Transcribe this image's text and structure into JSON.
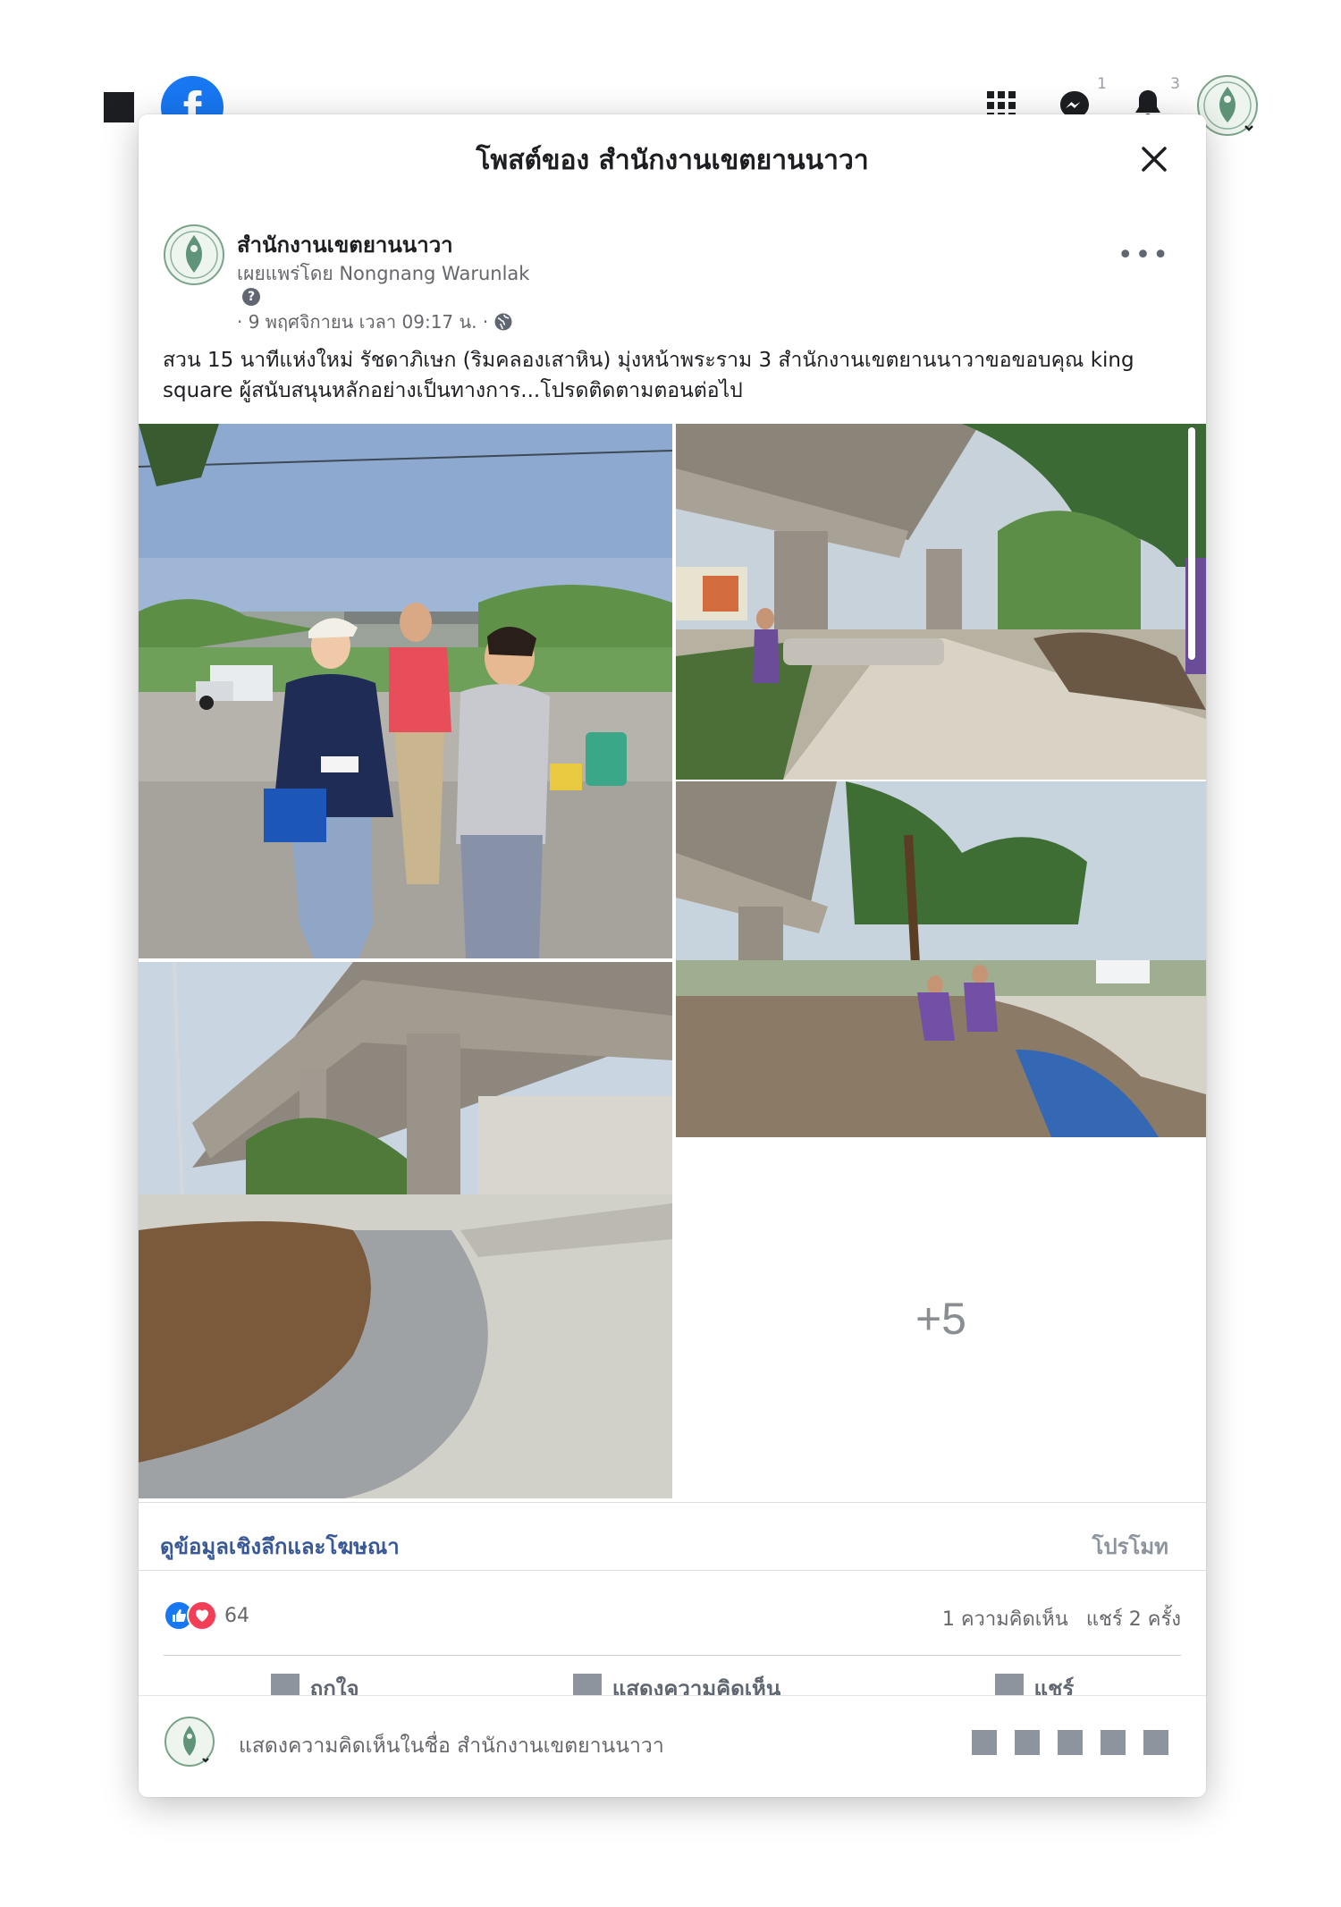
{
  "topbar": {
    "messenger_badge": "1",
    "notifications_badge": "3"
  },
  "modal": {
    "title": "โพสต์ของ สำนักงานเขตยานนาวา"
  },
  "post": {
    "page_name": "สำนักงานเขตยานนาวา",
    "published_by": "เผยแพร่โดย Nongnang Warunlak",
    "help_mark": "?",
    "date": "· 9 พฤศจิกายน เวลา 09:17 น. ·",
    "text": "สวน 15 นาทีแห่งใหม่ รัชดาภิเษก (ริมคลองเสาหิน) มุ่งหน้าพระราม 3 สำนักงานเขตยานนาวาขอขอบคุณ king square ผู้สนับสนุนหลักอย่างเป็นทางการ...โปรดติดตามตอนต่อไป",
    "more_photos": "+5"
  },
  "insights": {
    "link": "ดูข้อมูลเชิงลึกและโฆษณา",
    "promote": "โปรโมท"
  },
  "engagement": {
    "reaction_count": "64",
    "comments": "1 ความคิดเห็น",
    "shares": "แชร์ 2 ครั้ง"
  },
  "actions": {
    "like": "ถูกใจ",
    "comment": "แสดงความคิดเห็น",
    "share": "แชร์"
  },
  "comment_box": {
    "placeholder": "แสดงความคิดเห็นในชื่อ สำนักงานเขตยานนาวา"
  },
  "colors": {
    "facebook_blue": "#1877f2",
    "link_blue": "#385898",
    "love_red": "#f33e58"
  }
}
